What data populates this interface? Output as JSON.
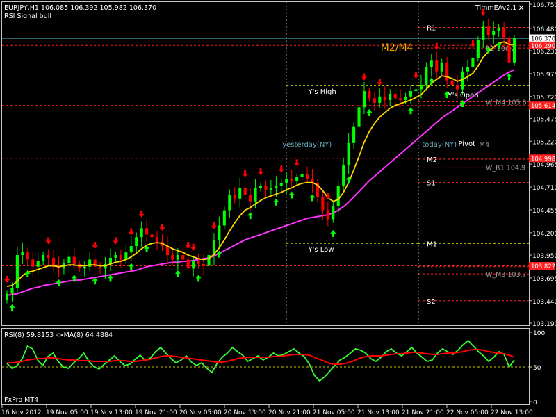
{
  "window": {
    "symbol_line": "EURJPY,H1  106.085 106.392 105.982 106.370",
    "indicator_name": "RSI Signal bull",
    "ea_name": "TimmEAv2.1",
    "close_glyph": "×",
    "broker": "FxPro MT4"
  },
  "colors": {
    "background": "#000000",
    "bull_candle": "#00ff00",
    "bear_candle": "#ff0000",
    "fast_ma": "#ffd700",
    "slow_ma": "#ff33ff",
    "rsi_line": "#33ff33",
    "rsi_ma": "#ff0000",
    "level_red": "#ff2020",
    "level_yellow": "#c8c800",
    "bid_line": "#4ccbd6",
    "grid_dashed": "#b0b0b0",
    "up_arrow": "#00ff00",
    "down_arrow": "#ff0000"
  },
  "chart_data": [
    {
      "type": "candlestick",
      "title": "EURJPY,H1",
      "ylim": [
        103.19,
        106.75
      ],
      "y_ticks": [
        "106.750",
        "106.480",
        "106.230",
        "105.975",
        "105.720",
        "105.475",
        "105.220",
        "104.965",
        "104.710",
        "104.455",
        "104.200",
        "103.950",
        "103.695",
        "103.440",
        "103.190"
      ],
      "x_ticks": [
        "16 Nov 2012",
        "19 Nov 05:00",
        "19 Nov 13:00",
        "19 Nov 21:00",
        "20 Nov 05:00",
        "20 Nov 13:00",
        "20 Nov 21:00",
        "21 Nov 05:00",
        "21 Nov 13:00",
        "21 Nov 21:00",
        "22 Nov 05:00",
        "22 Nov 13:00"
      ],
      "ohlc_open": [
        103.45,
        103.52,
        103.58,
        103.95,
        103.98,
        103.9,
        103.82,
        103.88,
        103.95,
        103.92,
        103.82,
        103.8,
        103.86,
        103.93,
        103.85,
        103.8,
        103.82,
        103.9,
        103.82,
        103.8,
        103.85,
        103.92,
        103.95,
        103.9,
        103.98,
        104.05,
        104.15,
        104.25,
        104.18,
        104.15,
        104.1,
        104.05,
        103.95,
        103.9,
        103.95,
        103.9,
        103.8,
        103.88,
        103.85,
        103.83,
        103.95,
        104.12,
        104.28,
        104.45,
        104.62,
        104.58,
        104.7,
        104.62,
        104.55,
        104.7,
        104.72,
        104.68,
        104.7,
        104.72,
        104.75,
        104.8,
        104.78,
        104.82,
        104.85,
        104.8,
        104.75,
        104.6,
        104.45,
        104.35,
        104.5,
        104.72,
        104.95,
        105.2,
        105.38,
        105.6,
        105.78,
        105.7,
        105.65,
        105.72,
        105.68,
        105.75,
        105.7,
        105.68,
        105.72,
        105.78,
        105.8,
        105.85,
        106.05,
        106.12,
        106.0,
        106.1,
        105.9,
        105.85,
        105.8,
        106.0,
        106.05,
        106.15,
        106.35,
        106.5,
        106.4,
        106.45,
        106.48,
        106.38,
        106.1
      ],
      "ohlc_close": [
        103.52,
        103.58,
        103.95,
        103.98,
        103.9,
        103.82,
        103.88,
        103.95,
        103.92,
        103.82,
        103.8,
        103.86,
        103.93,
        103.85,
        103.8,
        103.82,
        103.9,
        103.82,
        103.8,
        103.85,
        103.92,
        103.95,
        103.9,
        103.98,
        104.05,
        104.15,
        104.25,
        104.18,
        104.15,
        104.1,
        104.05,
        103.95,
        103.9,
        103.95,
        103.9,
        103.8,
        103.88,
        103.85,
        103.83,
        103.95,
        104.12,
        104.28,
        104.45,
        104.62,
        104.58,
        104.7,
        104.62,
        104.55,
        104.7,
        104.72,
        104.68,
        104.7,
        104.72,
        104.75,
        104.8,
        104.78,
        104.82,
        104.85,
        104.8,
        104.75,
        104.6,
        104.45,
        104.35,
        104.5,
        104.72,
        104.95,
        105.2,
        105.38,
        105.6,
        105.78,
        105.7,
        105.65,
        105.72,
        105.68,
        105.75,
        105.7,
        105.68,
        105.72,
        105.78,
        105.8,
        105.85,
        106.05,
        106.12,
        106.0,
        106.1,
        105.9,
        105.85,
        105.8,
        106.0,
        106.05,
        106.15,
        106.35,
        106.5,
        106.4,
        106.45,
        106.48,
        106.38,
        106.1,
        106.37
      ],
      "fast_ma": [
        103.6,
        103.61,
        103.66,
        103.72,
        103.76,
        103.77,
        103.79,
        103.81,
        103.83,
        103.83,
        103.82,
        103.83,
        103.84,
        103.84,
        103.83,
        103.83,
        103.84,
        103.84,
        103.83,
        103.83,
        103.85,
        103.87,
        103.88,
        103.9,
        103.93,
        103.97,
        104.02,
        104.06,
        104.08,
        104.09,
        104.08,
        104.05,
        104.02,
        104.0,
        103.98,
        103.95,
        103.93,
        103.91,
        103.9,
        103.91,
        103.96,
        104.03,
        104.12,
        104.22,
        104.31,
        104.39,
        104.45,
        104.48,
        104.52,
        104.56,
        104.59,
        104.61,
        104.63,
        104.65,
        104.68,
        104.7,
        104.73,
        104.75,
        104.76,
        104.76,
        104.73,
        104.67,
        104.59,
        104.55,
        104.57,
        104.65,
        104.76,
        104.9,
        105.05,
        105.21,
        105.33,
        105.42,
        105.49,
        105.54,
        105.59,
        105.62,
        105.64,
        105.66,
        105.68,
        105.71,
        105.74,
        105.8,
        105.87,
        105.91,
        105.95,
        105.94,
        105.92,
        105.89,
        105.91,
        105.94,
        105.98,
        106.06,
        106.16,
        106.22,
        106.27,
        106.31,
        106.33,
        106.3,
        106.3
      ],
      "slow_ma": [
        103.5,
        103.51,
        103.52,
        103.54,
        103.56,
        103.58,
        103.59,
        103.61,
        103.62,
        103.63,
        103.64,
        103.65,
        103.66,
        103.67,
        103.67,
        103.68,
        103.69,
        103.7,
        103.71,
        103.72,
        103.73,
        103.74,
        103.75,
        103.76,
        103.77,
        103.78,
        103.8,
        103.82,
        103.83,
        103.84,
        103.85,
        103.86,
        103.87,
        103.87,
        103.88,
        103.88,
        103.89,
        103.9,
        103.91,
        103.92,
        103.94,
        103.97,
        104.0,
        104.03,
        104.06,
        104.09,
        104.12,
        104.14,
        104.16,
        104.18,
        104.2,
        104.22,
        104.24,
        104.26,
        104.28,
        104.3,
        104.32,
        104.34,
        104.36,
        104.37,
        104.38,
        104.39,
        104.4,
        104.42,
        104.45,
        104.49,
        104.54,
        104.6,
        104.66,
        104.72,
        104.78,
        104.83,
        104.88,
        104.93,
        104.98,
        105.03,
        105.08,
        105.13,
        105.18,
        105.23,
        105.28,
        105.33,
        105.38,
        105.43,
        105.48,
        105.52,
        105.56,
        105.6,
        105.64,
        105.68,
        105.72,
        105.76,
        105.8,
        105.84,
        105.88,
        105.92,
        105.96,
        105.99,
        106.02
      ],
      "levels": [
        {
          "label": "R1",
          "price": 106.49,
          "color": "level_red"
        },
        {
          "label": "R2",
          "price": 106.26,
          "color": "level_red",
          "right_text": "R2 106.2"
        },
        {
          "label": "",
          "price": 105.84,
          "color": "level_yellow"
        },
        {
          "label": "W_M4",
          "price": 105.66,
          "color": "level_red",
          "right_text": "W_M4 105.6"
        },
        {
          "label": "",
          "price": 105.28,
          "color": "level_red"
        },
        {
          "label": "M2",
          "price": 105.02,
          "color": "level_red"
        },
        {
          "label": "W_R1",
          "price": 104.93,
          "color": "level_red",
          "right_text": "W_R1 104.9"
        },
        {
          "label": "S1",
          "price": 104.76,
          "color": "level_red"
        },
        {
          "label": "",
          "price": 104.08,
          "color": "level_yellow"
        },
        {
          "label": "M1",
          "price": 104.08,
          "color": "level_yellow"
        },
        {
          "label": "",
          "price": 103.82,
          "color": "level_red"
        },
        {
          "label": "W_M3",
          "price": 103.74,
          "color": "level_red",
          "right_text": "W_M3 103.7"
        },
        {
          "label": "S2",
          "price": 103.44,
          "color": "level_red"
        }
      ],
      "left_levels": [
        {
          "price": 106.29
        },
        {
          "price": 105.62
        },
        {
          "price": 105.03
        },
        {
          "price": 103.83
        }
      ],
      "price_tags": [
        {
          "text": "106.370",
          "price": 106.37,
          "kind": "bid"
        },
        {
          "text": "106.290",
          "price": 106.29,
          "kind": "red"
        },
        {
          "text": "105.614",
          "price": 105.62,
          "kind": "red"
        },
        {
          "text": "104.998",
          "price": 105.03,
          "kind": "red"
        },
        {
          "text": "103.822",
          "price": 103.83,
          "kind": "red"
        }
      ],
      "annotations": [
        {
          "text": "M2/M4",
          "price": 106.26,
          "bar": 73,
          "kind": "orange"
        },
        {
          "text": "Y's High",
          "price": 105.78,
          "bar": 59,
          "kind": "white"
        },
        {
          "text": "Y's Low",
          "price": 104.02,
          "bar": 59,
          "kind": "white"
        },
        {
          "text": "yesterday(NY)",
          "price": 105.19,
          "bar": 54,
          "kind": "teal"
        },
        {
          "text": "today(NY)",
          "price": 105.19,
          "bar": 81,
          "kind": "teal"
        },
        {
          "text": "Pivot",
          "price": 105.2,
          "bar": 88,
          "kind": "white"
        },
        {
          "text": "M4",
          "price": 105.19,
          "bar": 92,
          "kind": "gray"
        },
        {
          "text": "Y's Open",
          "price": 105.74,
          "bar": 86,
          "kind": "white"
        }
      ],
      "up_arrows": [
        1,
        4,
        10,
        13,
        17,
        20,
        24,
        27,
        33,
        37,
        41,
        47,
        52,
        55,
        59,
        63,
        66,
        70,
        78,
        82,
        85,
        88,
        93,
        95,
        97
      ],
      "down_arrows": [
        0,
        8,
        17,
        21,
        24,
        26,
        30,
        35,
        36,
        40,
        46,
        49,
        53,
        56,
        62,
        69,
        72,
        79,
        83,
        90,
        92
      ],
      "bid_price": 106.37
    },
    {
      "type": "line",
      "title": "RSI(8) 59.8153  ->MA(8) 64.4884",
      "ylim": [
        0,
        100
      ],
      "y_ticks": [
        "100",
        "50",
        "0"
      ],
      "level": 50,
      "series": [
        {
          "name": "RSI(8)",
          "color": "rsi_line",
          "values": [
            55,
            48,
            52,
            62,
            80,
            76,
            60,
            52,
            65,
            70,
            58,
            50,
            48,
            56,
            62,
            70,
            58,
            50,
            47,
            54,
            60,
            66,
            58,
            52,
            54,
            61,
            67,
            59,
            63,
            72,
            78,
            70,
            62,
            56,
            60,
            66,
            57,
            52,
            56,
            48,
            42,
            55,
            64,
            70,
            78,
            72,
            67,
            58,
            62,
            66,
            60,
            64,
            70,
            66,
            68,
            72,
            76,
            70,
            65,
            54,
            38,
            30,
            36,
            44,
            52,
            60,
            64,
            70,
            76,
            74,
            70,
            62,
            58,
            64,
            72,
            76,
            70,
            66,
            72,
            78,
            70,
            64,
            58,
            60,
            70,
            76,
            72,
            68,
            74,
            82,
            88,
            80,
            72,
            66,
            58,
            64,
            72,
            68,
            50,
            60
          ]
        },
        {
          "name": "MA(8)",
          "color": "rsi_ma",
          "values": [
            56,
            56,
            57,
            58,
            60,
            61,
            62,
            62,
            63,
            63,
            62,
            61,
            60,
            60,
            59,
            59,
            59,
            58,
            58,
            58,
            58,
            59,
            59,
            59,
            58,
            58,
            59,
            60,
            61,
            63,
            65,
            66,
            66,
            65,
            64,
            63,
            62,
            61,
            60,
            59,
            58,
            57,
            57,
            58,
            60,
            62,
            63,
            64,
            64,
            64,
            64,
            64,
            65,
            65,
            66,
            67,
            68,
            68,
            68,
            67,
            64,
            61,
            58,
            55,
            54,
            54,
            55,
            57,
            60,
            63,
            65,
            66,
            66,
            66,
            67,
            68,
            69,
            69,
            70,
            71,
            71,
            70,
            69,
            68,
            68,
            69,
            70,
            70,
            71,
            72,
            74,
            75,
            75,
            74,
            72,
            71,
            70,
            69,
            67,
            64
          ]
        }
      ]
    }
  ]
}
